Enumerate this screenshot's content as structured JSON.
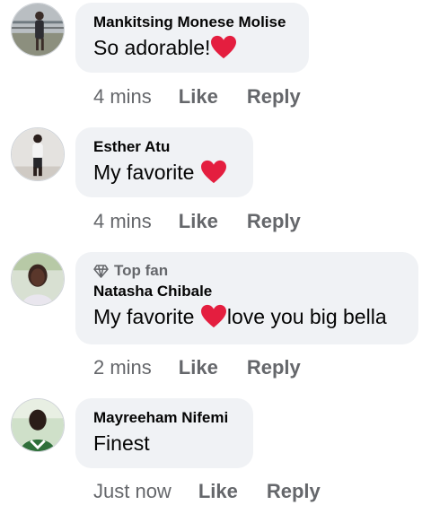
{
  "colors": {
    "bubble": "#f0f2f5",
    "meta": "#65676b",
    "text": "#050505",
    "heart": "#e41e3f"
  },
  "comments": [
    {
      "name": "Mankitsing Monese Molise",
      "text_before": "So adorable!",
      "text_after": "",
      "heart": "red-heart-emoji",
      "time": "4 mins",
      "like": "Like",
      "reply": "Reply"
    },
    {
      "name": "Esther Atu",
      "text_before": "My favorite ",
      "text_after": "",
      "heart": "red-heart-emoji",
      "time": "4 mins",
      "like": "Like",
      "reply": "Reply"
    },
    {
      "badge": "Top fan",
      "badge_icon": "diamond-icon",
      "name": "Natasha Chibale",
      "text_before": "My favorite ",
      "text_after": "love you big bella",
      "heart": "red-heart-emoji",
      "time": "2 mins",
      "like": "Like",
      "reply": "Reply"
    },
    {
      "name": "Mayreeham Nifemi",
      "text_before": "Finest",
      "text_after": "",
      "time": "Just now",
      "like": "Like",
      "reply": "Reply"
    }
  ]
}
